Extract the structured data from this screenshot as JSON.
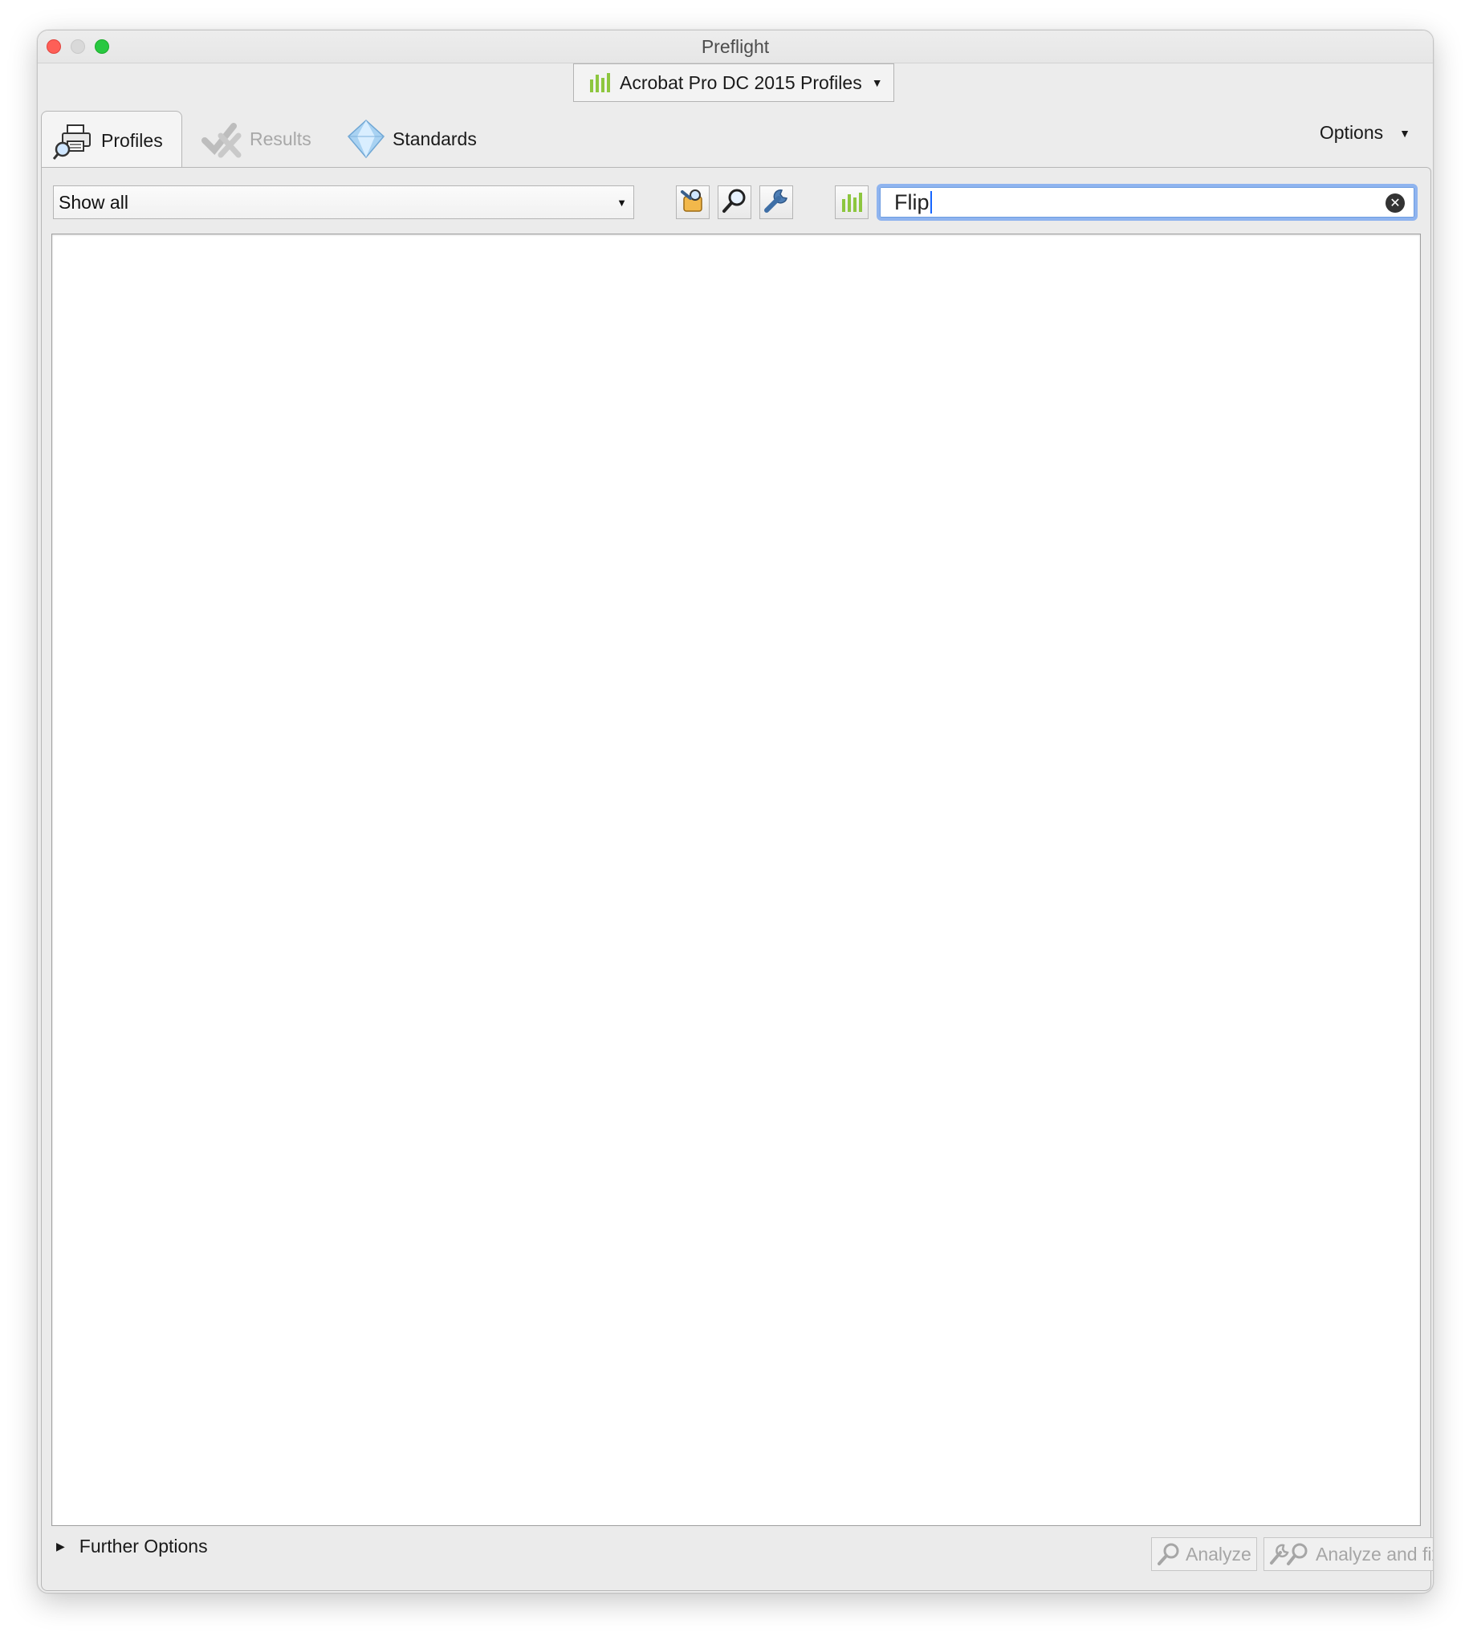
{
  "window": {
    "title": "Preflight"
  },
  "profile_library": {
    "selected": "Acrobat Pro DC 2015 Profiles",
    "icon": "green-bars-icon",
    "accent_color": "#8dc63f"
  },
  "tabs": [
    {
      "label": "Profiles",
      "icon": "printer-magnifier-icon",
      "active": true,
      "enabled": true
    },
    {
      "label": "Results",
      "icon": "checkmark-cross-icon",
      "active": false,
      "enabled": false
    },
    {
      "label": "Standards",
      "icon": "diamond-icon",
      "active": false,
      "enabled": true
    }
  ],
  "options": {
    "label": "Options"
  },
  "filter": {
    "selected": "Show all"
  },
  "toolbar": {
    "buttons": [
      {
        "name": "fixups-icon"
      },
      {
        "name": "magnifier-icon"
      },
      {
        "name": "wrench-icon"
      },
      {
        "name": "green-bars-icon"
      }
    ]
  },
  "search": {
    "value": "Flip"
  },
  "footer": {
    "further_options": "Further Options",
    "analyze_label": "Analyze",
    "analyze_fix_label": "Analyze and fix"
  }
}
